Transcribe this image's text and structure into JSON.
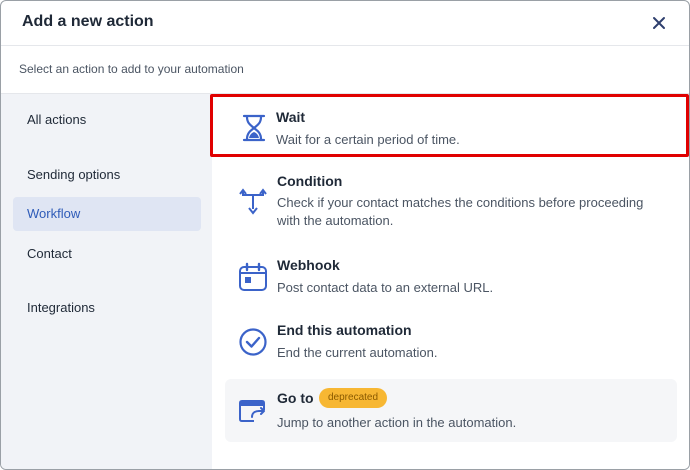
{
  "dialog": {
    "title": "Add a new action",
    "subtitle": "Select an action to add to your automation",
    "close_icon": "close-icon"
  },
  "sidebar": {
    "items": [
      {
        "label": "All actions",
        "active": false
      },
      {
        "label": "Sending options",
        "active": false
      },
      {
        "label": "Workflow",
        "active": true
      },
      {
        "label": "Contact",
        "active": false
      },
      {
        "label": "Integrations",
        "active": false
      }
    ]
  },
  "actions": [
    {
      "name": "Wait",
      "description": "Wait for a certain period of time.",
      "icon": "hourglass-icon",
      "highlighted": true
    },
    {
      "name": "Condition",
      "description": "Check if your contact matches the conditions before proceeding with the automation.",
      "icon": "branch-icon"
    },
    {
      "name": "Webhook",
      "description": "Post contact data to an external URL.",
      "icon": "calendar-webhook-icon"
    },
    {
      "name": "End this automation",
      "description": "End the current automation.",
      "icon": "check-circle-icon"
    },
    {
      "name": "Go to",
      "description": "Jump to another action in the automation.",
      "icon": "goto-window-icon",
      "badge": "deprecated"
    }
  ],
  "colors": {
    "accent": "#2e5bb8",
    "icon": "#3b63c9",
    "highlight_border": "#e00000",
    "badge_bg": "#f7b733",
    "sidebar_bg": "#f1f3f7",
    "sidebar_active_bg": "#dfe5f3"
  }
}
